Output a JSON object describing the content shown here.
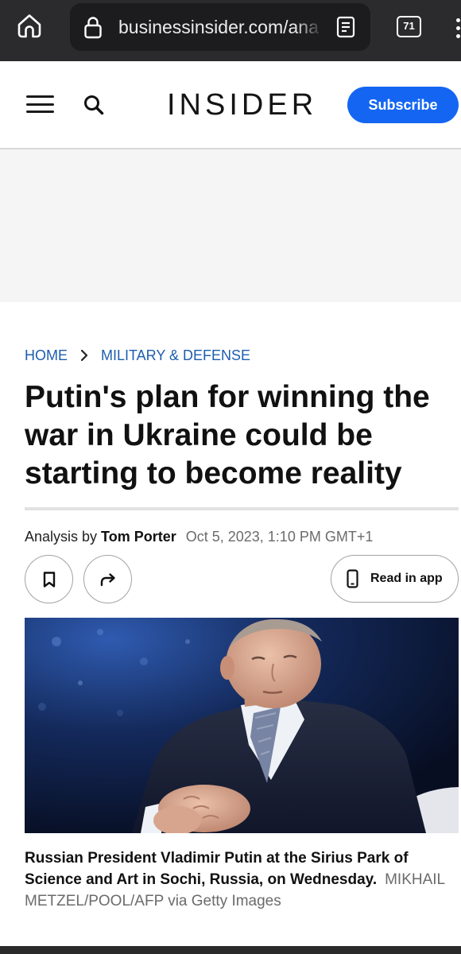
{
  "browser": {
    "url": "businessinsider.com/ana",
    "tab_count": "71"
  },
  "header": {
    "logo_text": "INSIDER",
    "subscribe_label": "Subscribe"
  },
  "breadcrumb": {
    "items": [
      "HOME",
      "MILITARY & DEFENSE"
    ]
  },
  "article": {
    "headline": "Putin's plan for winning the war in Ukraine could be starting to become reality",
    "byline": {
      "prefix": "Analysis by",
      "author": "Tom Porter",
      "published": "Oct 5, 2023, 1:10 PM GMT+1"
    },
    "actions": {
      "read_in_app_label": "Read in app"
    },
    "hero": {
      "caption": "Russian President Vladimir Putin at the Sirius Park of Science and Art in Sochi, Russia, on Wednesday.",
      "credit": "MIKHAIL METZEL/POOL/AFP via Getty Images"
    }
  },
  "icons": [
    "home-icon",
    "lock-icon",
    "reader-mode-icon",
    "tab-switcher-icon",
    "more-options-icon",
    "menu-icon",
    "search-icon",
    "chevron-right-icon",
    "bookmark-icon",
    "share-icon",
    "phone-icon"
  ],
  "colors": {
    "accent": "#1466f2",
    "link": "#1d5db0",
    "topbar": "#2b2b2d",
    "pill": "#1c1c1e",
    "text": "#111111",
    "muted": "#6b6b6b"
  }
}
